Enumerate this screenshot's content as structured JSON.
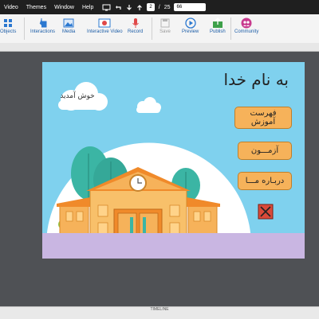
{
  "menubar": {
    "items": [
      "Video",
      "Themes",
      "Window",
      "Help"
    ],
    "page_current": "2",
    "page_separator": "/",
    "page_total": "25",
    "zoom": "66"
  },
  "toolbar": {
    "objects": "Objects",
    "interactions": "Interactions",
    "media": "Media",
    "interactive_video": "Interactive Video",
    "record": "Record",
    "save": "Save",
    "preview": "Preview",
    "publish": "Publish",
    "community": "Community"
  },
  "slide": {
    "title": "به نام خدا",
    "cloud_text": "خوش آمدید",
    "buttons": {
      "lesson_list": "فهرست\nآموزش",
      "quiz": "آزمـــون",
      "about_us": "دربـاره مـــا"
    }
  },
  "bottom": {
    "label": "TIMELINE"
  },
  "colors": {
    "sky": "#7fd1ee",
    "button": "#f6b25a",
    "building": "#f6b25a",
    "ground": "#c9b6e2",
    "accent": "#1f5fa8"
  },
  "icons": [
    "monitor-icon",
    "undo-icon",
    "download-icon",
    "upload-icon",
    "cursor-icon",
    "image-icon",
    "video-icon",
    "microphone-icon",
    "save-icon",
    "play-icon",
    "publish-icon",
    "community-icon",
    "clock-icon",
    "close-icon"
  ]
}
